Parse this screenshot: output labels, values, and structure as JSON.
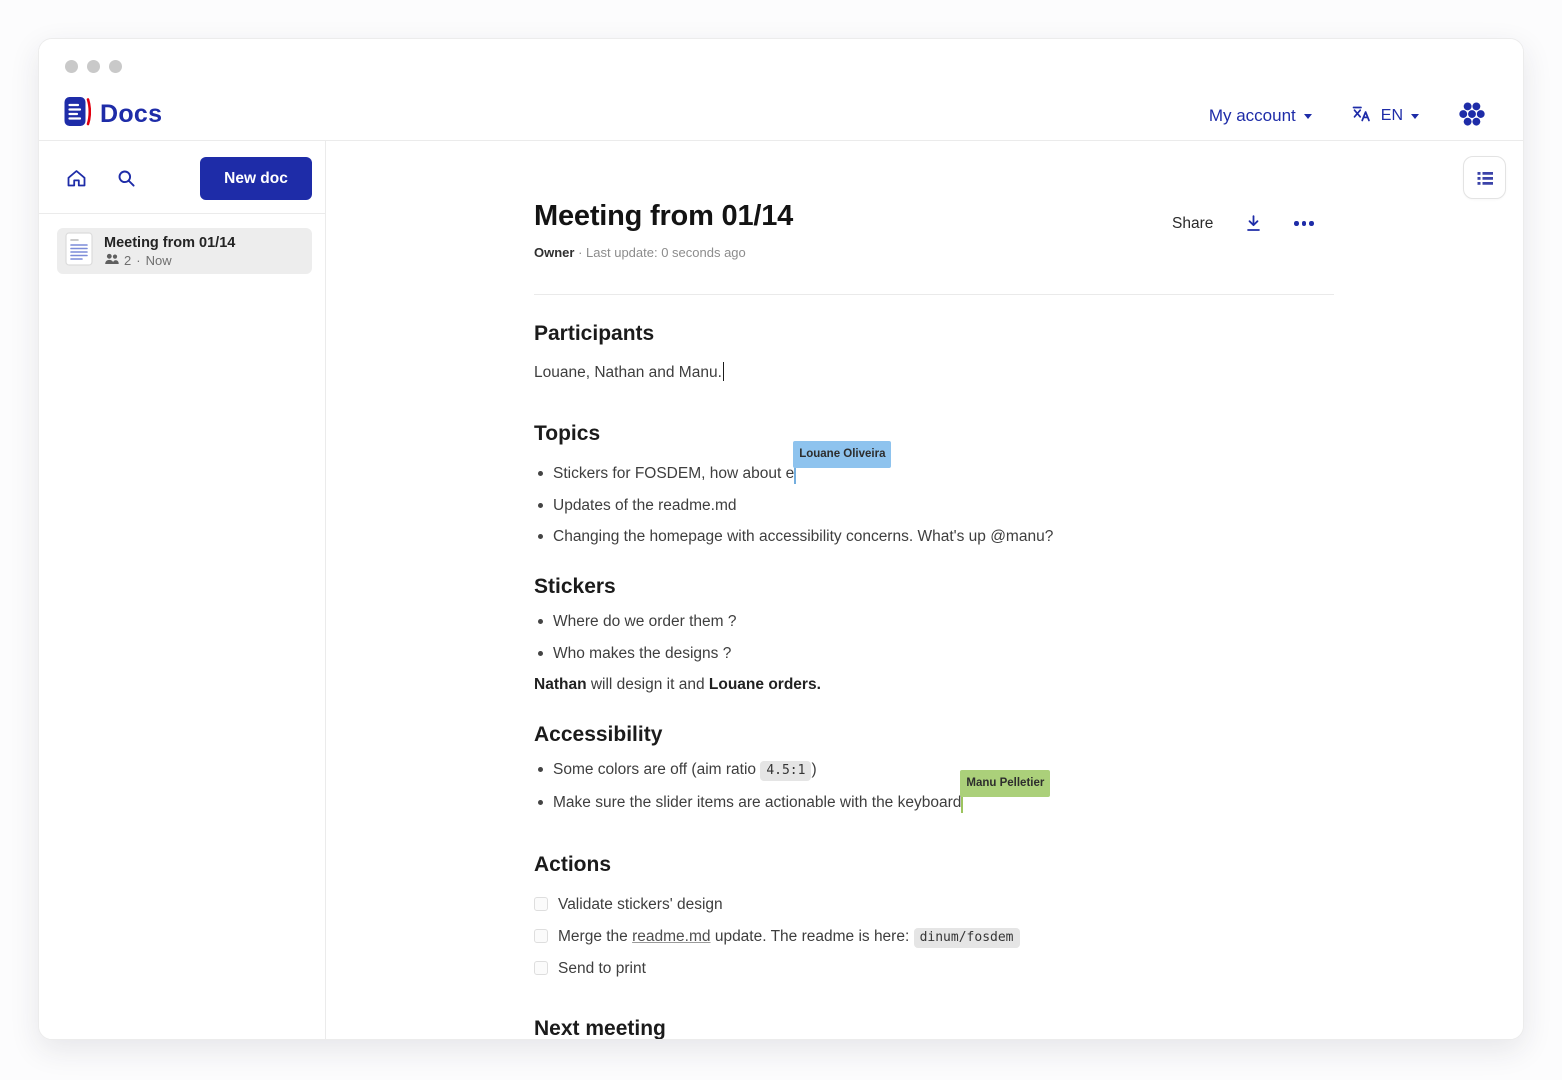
{
  "header": {
    "app_name": "Docs",
    "my_account": {
      "label": "My account"
    },
    "language": {
      "code": "EN"
    },
    "icons": {
      "logo": "docs-book-icon",
      "translate": "translate-icon",
      "apps": "gaufre-apps-icon"
    }
  },
  "sidebar": {
    "toolbar": {
      "new_doc_label": "New doc",
      "icons": {
        "home": "home-icon",
        "search": "search-icon"
      }
    },
    "documents": [
      {
        "title": "Meeting from 01/14",
        "members_count": "2",
        "separator": "·",
        "updated": "Now"
      }
    ]
  },
  "doc_header": {
    "title": "Meeting from 01/14",
    "owner_label": "Owner",
    "separator": " · ",
    "last_update": "Last update: 0 seconds ago",
    "share_label": "Share",
    "icons": {
      "download": "download-icon",
      "more": "more-options-icon",
      "toc": "table-of-contents-icon"
    }
  },
  "doc": {
    "participants": {
      "heading": "Participants",
      "text": "Louane, Nathan and Manu."
    },
    "topics": {
      "heading": "Topics",
      "items": [
        "Stickers for FOSDEM, how about e",
        "Updates of the readme.md",
        "Changing the homepage with accessibility concerns. What's up @manu?"
      ]
    },
    "stickers": {
      "heading": "Stickers",
      "items": [
        "Where do we order them ?",
        "Who makes the designs ?"
      ],
      "note_parts": {
        "bold1": "Nathan",
        "mid": " will design it and ",
        "bold2": "Louane",
        "end": " orders."
      }
    },
    "accessibility": {
      "heading": "Accessibility",
      "item1": {
        "pre": "Some colors are off (aim ratio ",
        "code": "4.5:1",
        "post": ")"
      },
      "item2": "Make sure the slider items are actionable with the keyboard"
    },
    "actions": {
      "heading": "Actions",
      "todo1": "Validate stickers' design",
      "todo2": {
        "pre": "Merge the ",
        "link": "readme.md",
        "mid": " update. The readme is here: ",
        "code": "dinum/fosdem"
      },
      "todo3": "Send to print"
    },
    "next_meeting": {
      "heading": "Next meeting"
    }
  },
  "collaborators": [
    {
      "name": "Louane Oliveira",
      "color": "#8ec3ee"
    },
    {
      "name": "Manu Pelletier",
      "color": "#abd07a"
    }
  ],
  "colors": {
    "brand_navy": "#1e2ca8",
    "accent_red": "#e1000f",
    "code_badge_bg": "#e5e5e5",
    "collab_blue": "#8ec3ee",
    "collab_green": "#abd07a"
  }
}
